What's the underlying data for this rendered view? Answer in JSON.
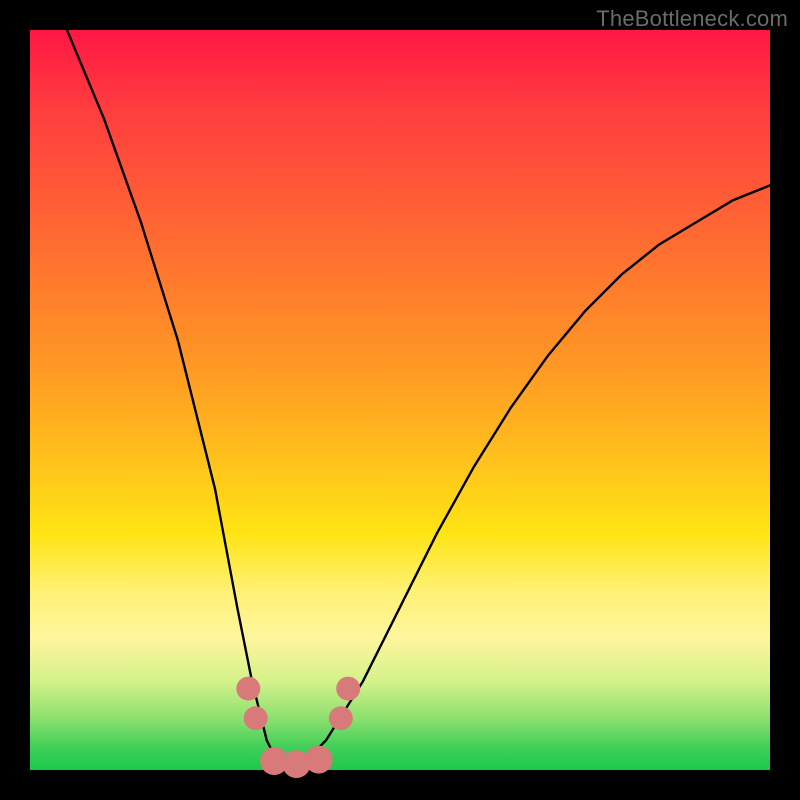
{
  "watermark": "TheBottleneck.com",
  "chart_data": {
    "type": "line",
    "title": "",
    "xlabel": "",
    "ylabel": "",
    "xlim": [
      0,
      100
    ],
    "ylim": [
      0,
      100
    ],
    "grid": false,
    "background_gradient": {
      "top": "#ff1744",
      "mid_upper": "#ff9a24",
      "mid_lower": "#fff176",
      "bottom": "#1cc94a"
    },
    "series": [
      {
        "name": "bottleneck-curve",
        "color": "#000000",
        "x": [
          5,
          10,
          15,
          20,
          25,
          28,
          30,
          32,
          34,
          36,
          40,
          45,
          50,
          55,
          60,
          65,
          70,
          75,
          80,
          85,
          90,
          95,
          100
        ],
        "y": [
          100,
          88,
          74,
          58,
          38,
          22,
          12,
          4,
          0,
          0,
          4,
          12,
          22,
          32,
          41,
          49,
          56,
          62,
          67,
          71,
          74,
          77,
          79
        ]
      }
    ],
    "markers": [
      {
        "name": "left-cluster-upper",
        "x": 29.5,
        "y": 11,
        "color": "#d97a7a",
        "size": 12
      },
      {
        "name": "left-cluster-lower",
        "x": 30.5,
        "y": 7,
        "color": "#d97a7a",
        "size": 12
      },
      {
        "name": "floor-segment-left",
        "x": 33,
        "y": 1.2,
        "color": "#d97a7a",
        "size": 14
      },
      {
        "name": "floor-segment-mid",
        "x": 36,
        "y": 0.8,
        "color": "#d97a7a",
        "size": 14
      },
      {
        "name": "floor-segment-right",
        "x": 39,
        "y": 1.4,
        "color": "#d97a7a",
        "size": 14
      },
      {
        "name": "right-cluster-lower",
        "x": 42,
        "y": 7,
        "color": "#d97a7a",
        "size": 12
      },
      {
        "name": "right-cluster-upper",
        "x": 43,
        "y": 11,
        "color": "#d97a7a",
        "size": 12
      }
    ]
  }
}
